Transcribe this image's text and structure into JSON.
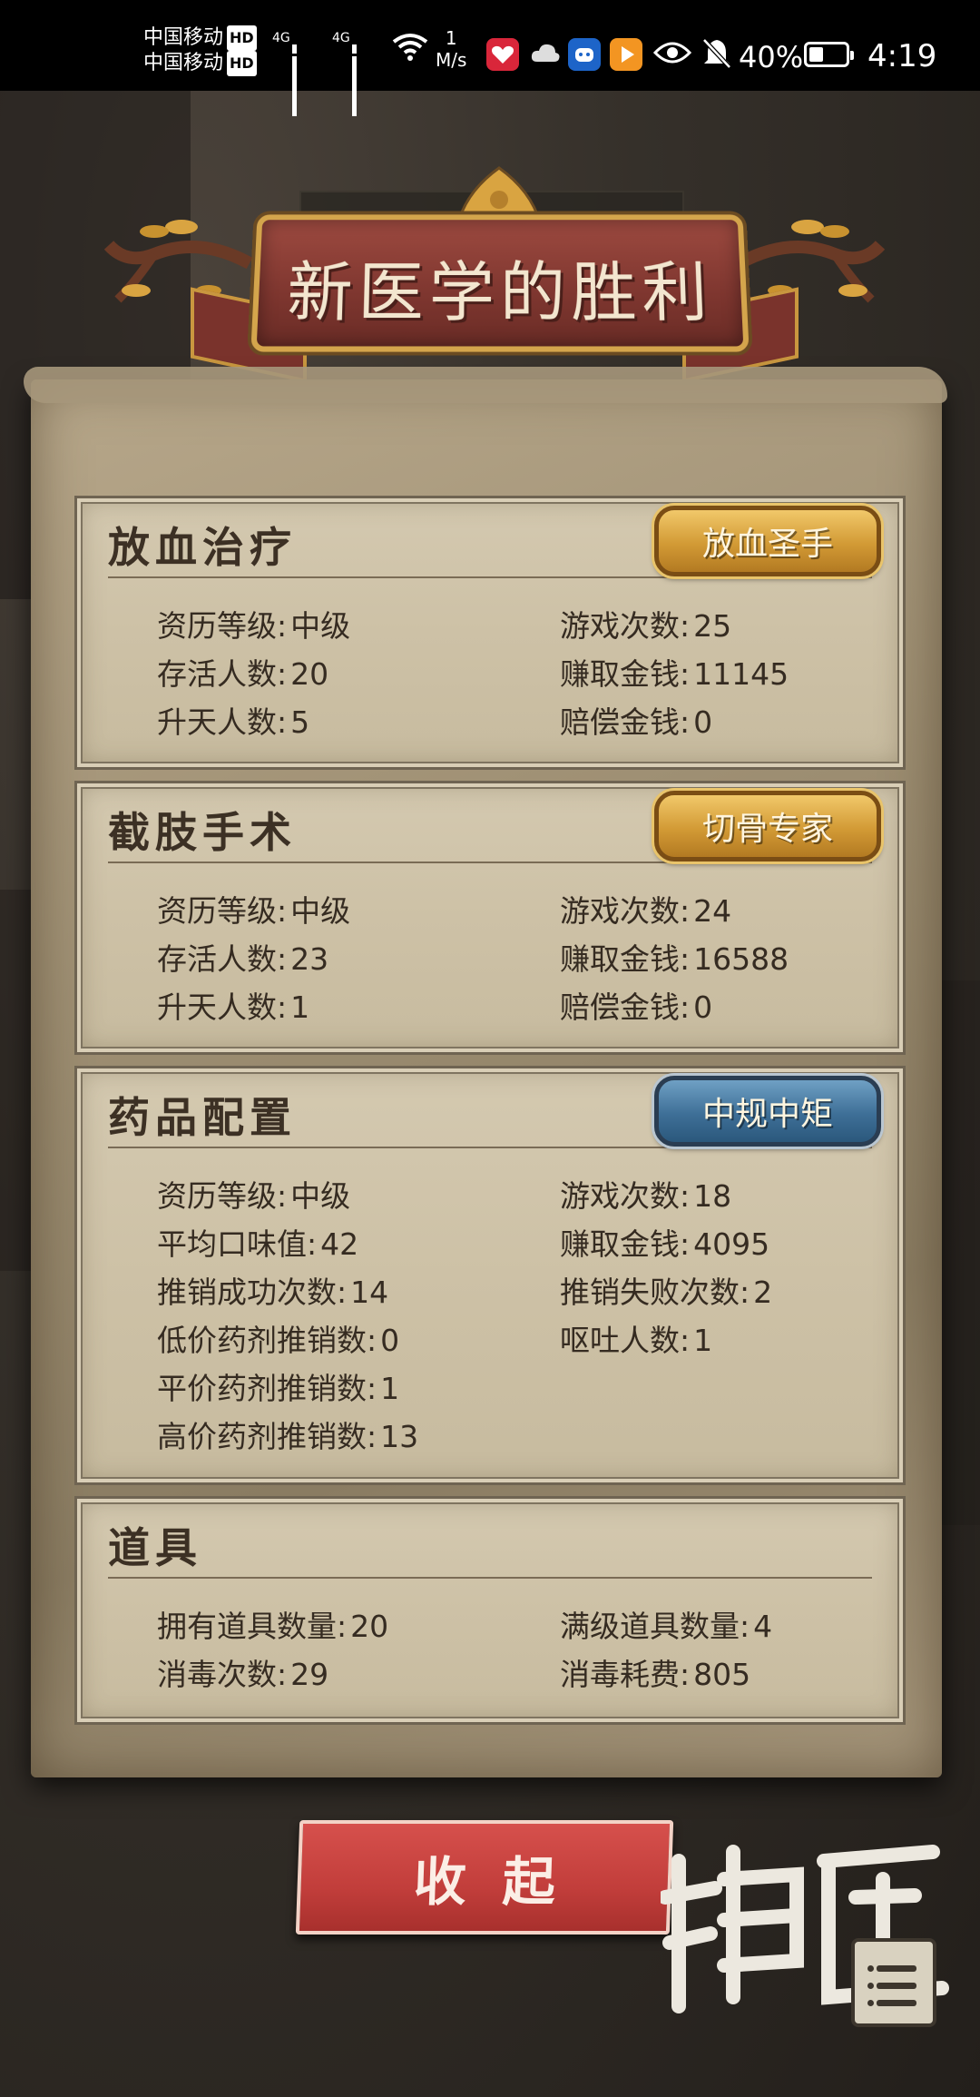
{
  "status_bar": {
    "carrier_1": "中国移动",
    "carrier_2": "中国移动",
    "hd_badge": "HD",
    "network_1": "4G",
    "network_2": "4G",
    "speed_value": "1",
    "speed_unit": "M/s",
    "battery_percent": "40%",
    "battery_level": 0.4,
    "time": "4:19",
    "icons": [
      "signal-icon",
      "wifi-icon",
      "app-heart-icon",
      "cloud-icon",
      "app-robot-icon",
      "app-play-icon",
      "eye-icon",
      "bell-muted-icon",
      "battery-icon"
    ]
  },
  "banner": {
    "title": "新医学的胜利"
  },
  "panels": {
    "bloodletting": {
      "title": "放血治疗",
      "badge": "放血圣手",
      "stats": [
        {
          "label": "资历等级:",
          "value": "中级"
        },
        {
          "label": "游戏次数:",
          "value": "25"
        },
        {
          "label": "存活人数:",
          "value": "20"
        },
        {
          "label": "赚取金钱:",
          "value": "11145"
        },
        {
          "label": "升天人数:",
          "value": "5"
        },
        {
          "label": "赔偿金钱:",
          "value": "0"
        }
      ]
    },
    "amputation": {
      "title": "截肢手术",
      "badge": "切骨专家",
      "stats": [
        {
          "label": "资历等级:",
          "value": "中级"
        },
        {
          "label": "游戏次数:",
          "value": "24"
        },
        {
          "label": "存活人数:",
          "value": "23"
        },
        {
          "label": "赚取金钱:",
          "value": "16588"
        },
        {
          "label": "升天人数:",
          "value": "1"
        },
        {
          "label": "赔偿金钱:",
          "value": "0"
        }
      ]
    },
    "medicine": {
      "title": "药品配置",
      "badge": "中规中矩",
      "stats": [
        {
          "label": "资历等级:",
          "value": "中级"
        },
        {
          "label": "游戏次数:",
          "value": "18"
        },
        {
          "label": "平均口味值:",
          "value": "42"
        },
        {
          "label": "赚取金钱:",
          "value": "4095"
        },
        {
          "label": "推销成功次数:",
          "value": "14"
        },
        {
          "label": "推销失败次数:",
          "value": "2"
        },
        {
          "label": "低价药剂推销数:",
          "value": "0"
        },
        {
          "label": "呕吐人数:",
          "value": "1"
        },
        {
          "label": "平价药剂推销数:",
          "value": "1"
        },
        {
          "label": "高价药剂推销数:",
          "value": "13"
        }
      ]
    },
    "items": {
      "title": "道具",
      "stats": [
        {
          "label": "拥有道具数量:",
          "value": "20"
        },
        {
          "label": "满级道具数量:",
          "value": "4"
        },
        {
          "label": "消毒次数:",
          "value": "29"
        },
        {
          "label": "消毒耗费:",
          "value": "805"
        }
      ]
    }
  },
  "buttons": {
    "collapse": "收起"
  },
  "logo": {
    "text": "神医"
  }
}
